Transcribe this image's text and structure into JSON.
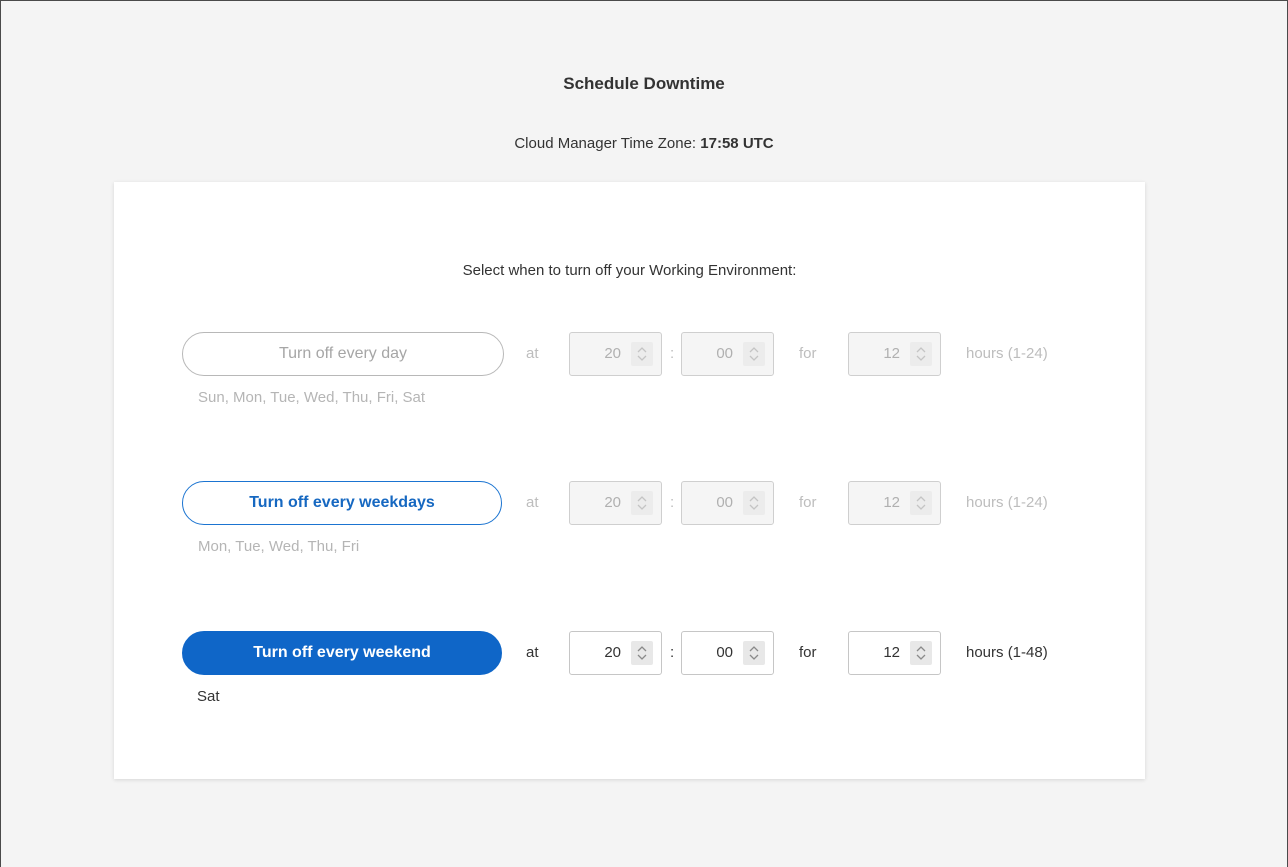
{
  "page": {
    "title": "Schedule Downtime",
    "timezone_label": "Cloud Manager Time Zone:",
    "timezone_value": "17:58 UTC"
  },
  "card": {
    "instruction": "Select when to turn off your Working Environment:"
  },
  "options": [
    {
      "label": "Turn off every day",
      "state": "inactive",
      "days": "Sun, Mon, Tue, Wed, Thu, Fri, Sat",
      "at_label": "at",
      "hour": "20",
      "separator": ":",
      "minute": "00",
      "for_label": "for",
      "duration": "12",
      "hours_label": "hours (1-24)"
    },
    {
      "label": "Turn off every weekdays",
      "state": "outlined",
      "days": "Mon, Tue, Wed, Thu, Fri",
      "at_label": "at",
      "hour": "20",
      "separator": ":",
      "minute": "00",
      "for_label": "for",
      "duration": "12",
      "hours_label": "hours (1-24)"
    },
    {
      "label": "Turn off every weekend",
      "state": "selected",
      "days": "Sat",
      "at_label": "at",
      "hour": "20",
      "separator": ":",
      "minute": "00",
      "for_label": "for",
      "duration": "12",
      "hours_label": "hours (1-48)"
    }
  ],
  "icons": {
    "stepper": "chevron-up-down-icon"
  },
  "colors": {
    "accent": "#0f66c8",
    "accent_text": "#1668c1",
    "background": "#f4f4f4",
    "card": "#ffffff",
    "disabled_text": "#b5b5b5"
  }
}
